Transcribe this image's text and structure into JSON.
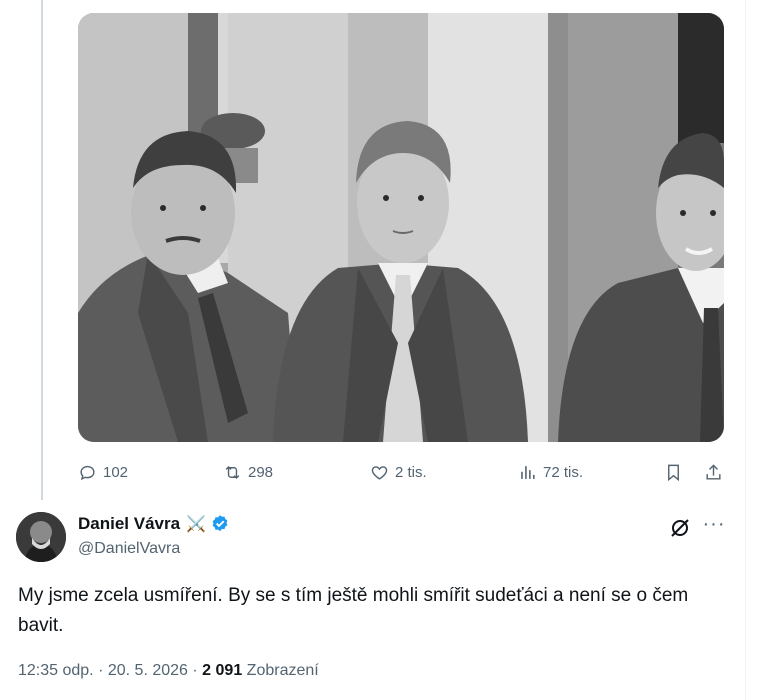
{
  "post": {
    "photo_alt": "",
    "actions": {
      "replies": "102",
      "reposts": "298",
      "likes": "2 tis.",
      "views": "72 tis."
    }
  },
  "author": {
    "name": "Daniel Vávra",
    "name_emoji": "⚔️",
    "handle": "@DanielVavra",
    "more_label": "···"
  },
  "tweet": {
    "text": "My jsme zcela usmíření. By se s tím ještě mohli smířit sudeťáci a není se o čem bavit."
  },
  "meta": {
    "time": "12:35 odp.",
    "separator": "·",
    "date": "20. 5. 2026",
    "views_count": "2 091",
    "views_label": "Zobrazení"
  },
  "colors": {
    "text_primary": "#0f1419",
    "text_secondary": "#536471",
    "verified": "#1d9bf0",
    "thread_line": "#cfd9de"
  }
}
